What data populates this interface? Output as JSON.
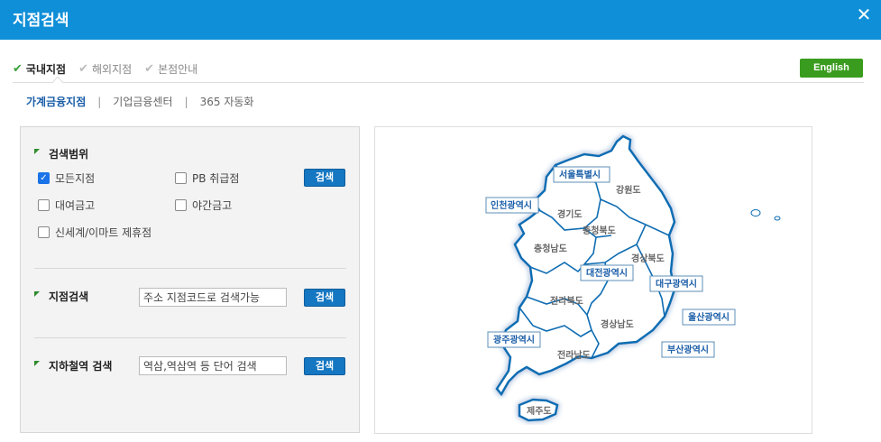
{
  "window": {
    "title": "지점검색",
    "close_glyph": "✕"
  },
  "top_tabs": [
    {
      "label": "국내지점",
      "active": true
    },
    {
      "label": "해외지점",
      "active": false
    },
    {
      "label": "본점안내",
      "active": false
    }
  ],
  "english_button": "English",
  "sub_tabs": [
    {
      "label": "가계금융지점",
      "active": true
    },
    {
      "label": "기업금융센터",
      "active": false
    },
    {
      "label": "365 자동화",
      "active": false
    }
  ],
  "separator": "|",
  "scope": {
    "heading": "검색범위",
    "options": [
      {
        "label": "모든지점",
        "checked": true
      },
      {
        "label": "PB 취급점",
        "checked": false
      },
      {
        "label": "대여금고",
        "checked": false
      },
      {
        "label": "야간금고",
        "checked": false
      },
      {
        "label": "신세계/이마트 제휴점",
        "checked": false
      }
    ],
    "button": "검색"
  },
  "branch_search": {
    "heading": "지점검색",
    "value": "주소 지점코드로 검색가능",
    "button": "검색"
  },
  "subway_search": {
    "heading": "지하철역 검색",
    "value": "역삼,역삼역 등 단어 검색",
    "button": "검색"
  },
  "map": {
    "regions": [
      "강원도",
      "경기도",
      "충청북도",
      "충청남도",
      "경상북도",
      "전라북도",
      "경상남도",
      "전라남도",
      "제주도"
    ],
    "cities": [
      "서울특별시",
      "인천광역시",
      "대전광역시",
      "대구광역시",
      "울산광역시",
      "광주광역시",
      "부산광역시"
    ]
  },
  "colors": {
    "titlebar": "#0f8fd8",
    "english": "#3a9c1e",
    "button": "#1577c2",
    "map_border": "#0f6db3"
  }
}
